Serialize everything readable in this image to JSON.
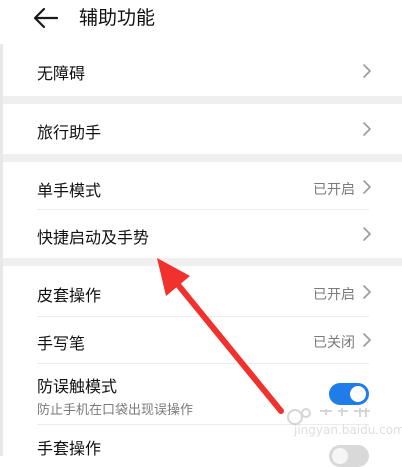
{
  "header": {
    "back_icon": "arrow-left-icon",
    "title": "辅助功能"
  },
  "groups": [
    {
      "items": [
        {
          "label": "无障碍",
          "status": "",
          "control": "chevron"
        }
      ]
    },
    {
      "items": [
        {
          "label": "旅行助手",
          "status": "",
          "control": "chevron"
        }
      ]
    },
    {
      "items": [
        {
          "label": "单手模式",
          "status": "已开启",
          "control": "chevron"
        },
        {
          "label": "快捷启动及手势",
          "status": "",
          "control": "chevron"
        }
      ]
    },
    {
      "items": [
        {
          "label": "皮套操作",
          "status": "已开启",
          "control": "chevron"
        },
        {
          "label": "手写笔",
          "status": "已关闭",
          "control": "chevron"
        },
        {
          "label": "防误触模式",
          "sublabel": "防止手机在口袋出现误操作",
          "control": "toggle",
          "toggle_on": true
        },
        {
          "label": "手套操作",
          "control": "toggle",
          "toggle_on": false
        }
      ]
    }
  ],
  "watermark": {
    "text": "jingyan.baidu.com"
  },
  "colors": {
    "accent": "#1f7ce8",
    "annotation_arrow": "#f0312e",
    "section_gap": "#efefef",
    "secondary_text": "#7a7a7a"
  }
}
